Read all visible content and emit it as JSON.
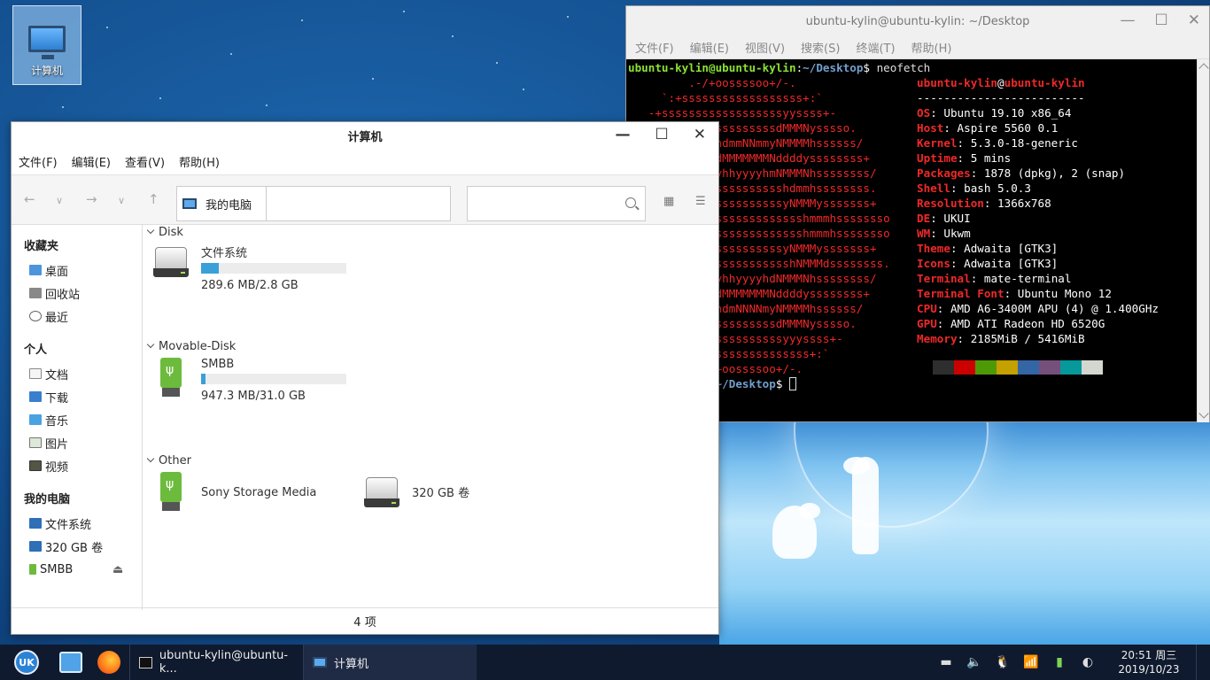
{
  "desktop": {
    "icon_label": "计算机"
  },
  "terminal": {
    "title": "ubuntu-kylin@ubuntu-kylin: ~/Desktop",
    "menu": [
      "文件(F)",
      "编辑(E)",
      "视图(V)",
      "搜索(S)",
      "终端(T)",
      "帮助(H)"
    ],
    "prompt_user": "ubuntu-kylin@ubuntu-kylin",
    "prompt_path": "~/Desktop",
    "command": "neofetch",
    "prompt_user_partial": "ubuntu-kylin",
    "info_user": "ubuntu-kylin",
    "info_host": "ubuntu-kylin",
    "separator": "-------------------------",
    "info": [
      {
        "k": "OS",
        "v": "Ubuntu 19.10 x86_64"
      },
      {
        "k": "Host",
        "v": "Aspire 5560 0.1"
      },
      {
        "k": "Kernel",
        "v": "5.3.0-18-generic"
      },
      {
        "k": "Uptime",
        "v": "5 mins"
      },
      {
        "k": "Packages",
        "v": "1878 (dpkg), 2 (snap)"
      },
      {
        "k": "Shell",
        "v": "bash 5.0.3"
      },
      {
        "k": "Resolution",
        "v": "1366x768"
      },
      {
        "k": "DE",
        "v": "UKUI"
      },
      {
        "k": "WM",
        "v": "Ukwm"
      },
      {
        "k": "Theme",
        "v": "Adwaita [GTK3]"
      },
      {
        "k": "Icons",
        "v": "Adwaita [GTK3]"
      },
      {
        "k": "Terminal",
        "v": "mate-terminal"
      },
      {
        "k": "Terminal Font",
        "v": "Ubuntu Mono 12"
      },
      {
        "k": "CPU",
        "v": "AMD A6-3400M APU (4) @ 1.400GHz"
      },
      {
        "k": "GPU",
        "v": "AMD ATI Radeon HD 6520G"
      },
      {
        "k": "Memory",
        "v": "2185MiB / 5416MiB"
      }
    ],
    "logo": [
      "         .-/+oossssoo+/-.",
      "     `:+ssssssssssssssssss+:`",
      "   -+ssssssssssssssssssyyssss+-",
      "           sssssssssssdMMMNysssso.",
      "           sshdmmNNmmyNMMMMhssssss/",
      "           mydMMMMMMMNddddyssssssss+",
      "           MMyhhyyyyhmNMMMNhssssssss/",
      "           Nhsssssssssshdmmhssssssss.",
      "           ysssssssssssyNMMMysssssss+",
      "           ssssssssssssssshmmmhssssssso",
      "           ssssssssssssssshmmmhssssssso",
      "           ysssssssssssyNMMMysssssss+",
      "           NhssssssssssshNMMMdssssssss.",
      "           MMyhhyyyyhdNMMMNhssssssss/",
      "           mydMMMMMMMNddddyssssssss+",
      "           sshdmNNNNmyNMMMMhssssss/",
      "           sssssssssssdMMMNysssso.",
      "           ssssssssssssyyyssss+-",
      "           ssssssssssssssss+:`",
      "           -/+oossssoo+/-."
    ],
    "palette": [
      "#2e2e2e",
      "#cc0000",
      "#4e9a06",
      "#c4a000",
      "#3465a4",
      "#75507b",
      "#06989a",
      "#d3d7cf"
    ]
  },
  "filemanager": {
    "title": "计算机",
    "menu": [
      "文件(F)",
      "编辑(E)",
      "查看(V)",
      "帮助(H)"
    ],
    "address": "我的电脑",
    "search_placeholder": "",
    "sidebar": {
      "favorites_title": "收藏夹",
      "favorites": [
        "桌面",
        "回收站",
        "最近"
      ],
      "personal_title": "个人",
      "personal": [
        "文档",
        "下载",
        "音乐",
        "图片",
        "视频"
      ],
      "computer_title": "我的电脑",
      "computer": [
        "文件系统",
        "320 GB 卷",
        "SMBB"
      ]
    },
    "groups": {
      "disk": {
        "label": "Disk",
        "items": [
          {
            "name": "文件系统",
            "usage": "289.6 MB/2.8 GB",
            "fill": 0.12
          }
        ]
      },
      "movable": {
        "label": "Movable-Disk",
        "items": [
          {
            "name": "SMBB",
            "usage": "947.3 MB/31.0 GB",
            "fill": 0.03
          }
        ]
      },
      "other": {
        "label": "Other",
        "items": [
          {
            "name": "Sony Storage Media"
          },
          {
            "name": "320 GB 卷"
          }
        ]
      }
    },
    "status": "4 项"
  },
  "taskbar": {
    "tasks": [
      {
        "label": "ubuntu-kylin@ubuntu-k..."
      },
      {
        "label": "计算机"
      }
    ],
    "clock_time": "20:51 周三",
    "clock_date": "2019/10/23"
  }
}
